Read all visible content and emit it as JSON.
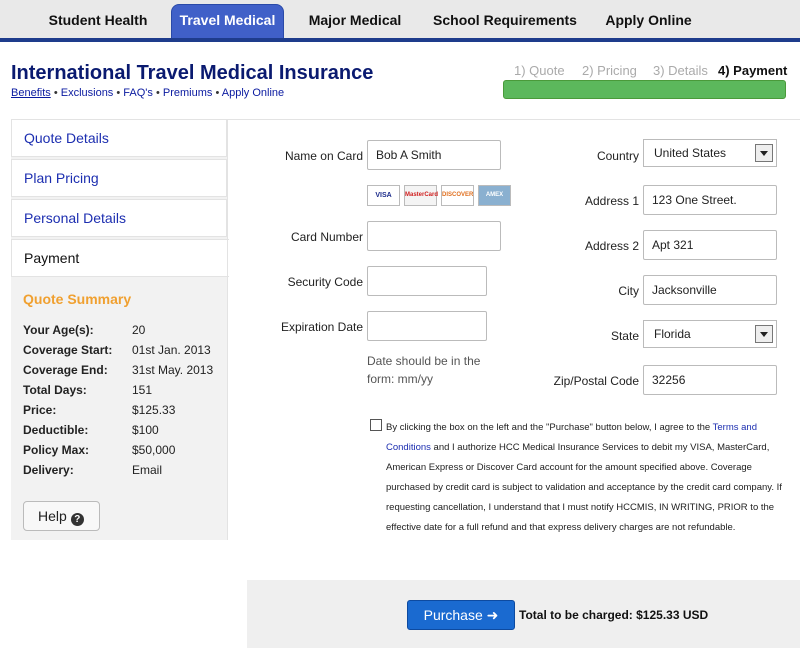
{
  "nav": {
    "tabs": [
      "Student Health",
      "Travel Medical",
      "Major Medical",
      "School Requirements",
      "Apply Online"
    ],
    "active_index": 1
  },
  "header": {
    "title": "International Travel Medical Insurance",
    "links": [
      "Benefits",
      "Exclusions",
      "FAQ's",
      "Premiums",
      "Apply Online"
    ],
    "separator": "•"
  },
  "steps": {
    "items": [
      "1) Quote",
      "2) Pricing",
      "3) Details",
      "4) Payment"
    ],
    "current_index": 3,
    "progress": 1.0,
    "progress_color": "#5cb85c"
  },
  "sidebar": {
    "items": [
      "Quote Details",
      "Plan Pricing",
      "Personal Details",
      "Payment"
    ],
    "active_index": 3,
    "quote_summary": {
      "title": "Quote Summary",
      "rows": [
        {
          "k": "Your Age(s):",
          "v": "20"
        },
        {
          "k": "Coverage Start:",
          "v": "01st Jan. 2013"
        },
        {
          "k": "Coverage End:",
          "v": "31st May. 2013"
        },
        {
          "k": "Total Days:",
          "v": "151"
        },
        {
          "k": "Price:",
          "v": "$125.33"
        },
        {
          "k": "Deductible:",
          "v": "$100"
        },
        {
          "k": "Policy Max:",
          "v": "$50,000"
        },
        {
          "k": "Delivery:",
          "v": "Email"
        }
      ]
    },
    "help_label": "Help",
    "help_icon": "?"
  },
  "form": {
    "name_label": "Name on Card",
    "name_value": "Bob A Smith",
    "cards": [
      "VISA",
      "MasterCard",
      "DISCOVER",
      "AMEX"
    ],
    "card_number_label": "Card Number",
    "card_number_value": "",
    "security_label": "Security Code",
    "security_value": "",
    "expiration_label": "Expiration Date",
    "expiration_value": "",
    "expiration_hint": "Date should be in the form: mm/yy",
    "country_label": "Country",
    "country_value": "United States",
    "address1_label": "Address 1",
    "address1_value": "123 One Street.",
    "address2_label": "Address 2",
    "address2_value": "Apt 321",
    "city_label": "City",
    "city_value": "Jacksonville",
    "state_label": "State",
    "state_value": "Florida",
    "zip_label": "Zip/Postal Code",
    "zip_value": "32256"
  },
  "terms": {
    "text_before": "By clicking the box on the left and the \"Purchase\" button below, I agree to the ",
    "link": "Terms and Conditions",
    "text_after": " and I authorize HCC Medical Insurance Services to debit my VISA, MasterCard, American Express or Discover Card account for the amount specified above. Coverage purchased by credit card is subject to validation and acceptance by the credit card company. If requesting cancellation, I understand that I must notify HCCMIS, IN WRITING, PRIOR to the effective date for a full refund and that express delivery charges are not refundable.",
    "checked": false
  },
  "footer": {
    "purchase_label": "Purchase ➜",
    "total_text": "Total to be charged: $125.33 USD"
  }
}
